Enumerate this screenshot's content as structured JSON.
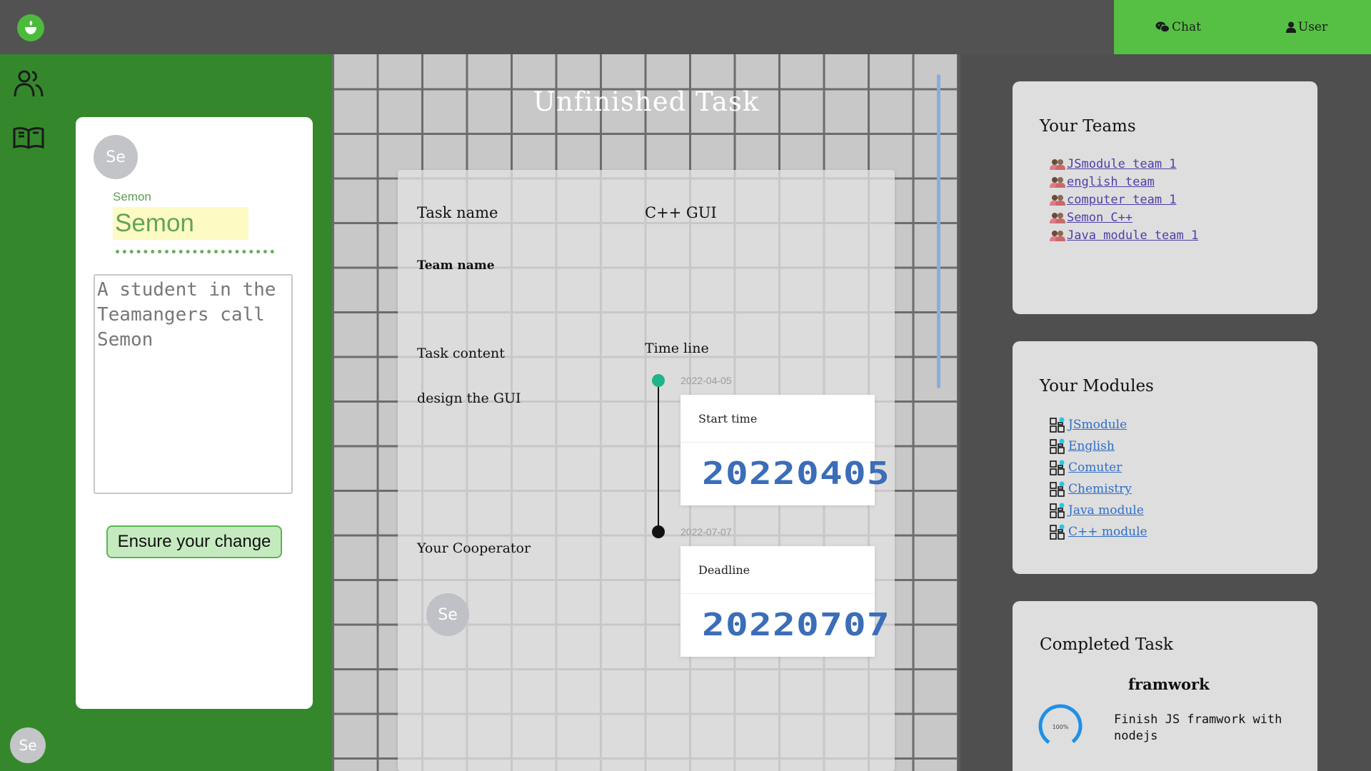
{
  "topbar": {
    "nav": [
      {
        "label": "Chat",
        "icon": "wechat-icon"
      },
      {
        "label": "User",
        "icon": "user-icon"
      }
    ]
  },
  "sidebar": {
    "icons": [
      "team-icon",
      "book-icon"
    ],
    "bottom_avatar": "Se"
  },
  "profile": {
    "avatar": "Se",
    "label": "Semon",
    "name_value": "Semon",
    "bio": "A student in the Teamangers call Semon",
    "ensure_button": "Ensure your change"
  },
  "main": {
    "title": "Unfinished Task",
    "task": {
      "name_label": "Task name",
      "name_value": "C++ GUI",
      "team_label": "Team name",
      "team_value": "",
      "content_label": "Task content",
      "content_value": "design the GUI",
      "cooperator_label": "Your Cooperator",
      "cooperator_avatar": "Se",
      "timeline_label": "Time line",
      "timeline": [
        {
          "date": "2022-04-05",
          "title": "Start time",
          "value": "20220405",
          "dot_color": "#1fb489"
        },
        {
          "date": "2022-07-07",
          "title": "Deadline",
          "value": "20220707",
          "dot_color": "#111111"
        }
      ]
    }
  },
  "right": {
    "teams": {
      "title": "Your Teams",
      "items": [
        "JSmodule team 1",
        "english team",
        "computer team 1",
        "Semon C++",
        "Java module team 1"
      ]
    },
    "modules": {
      "title": "Your Modules",
      "items": [
        "JSmodule",
        "English",
        "Comuter",
        "Chemistry",
        "Java module",
        "C++ module"
      ]
    },
    "completed": {
      "title": "Completed Task",
      "task_name": "framwork",
      "progress_label": "100%",
      "progress": 1.0,
      "description": "Finish JS framwork with nodejs"
    }
  },
  "colors": {
    "topbar": "#525252",
    "nav_green": "#55c043",
    "sidebar_green": "#34882b",
    "link_purple": "#4c3fa8",
    "link_blue": "#2f6ec7",
    "progress_blue": "#1e90e8"
  }
}
